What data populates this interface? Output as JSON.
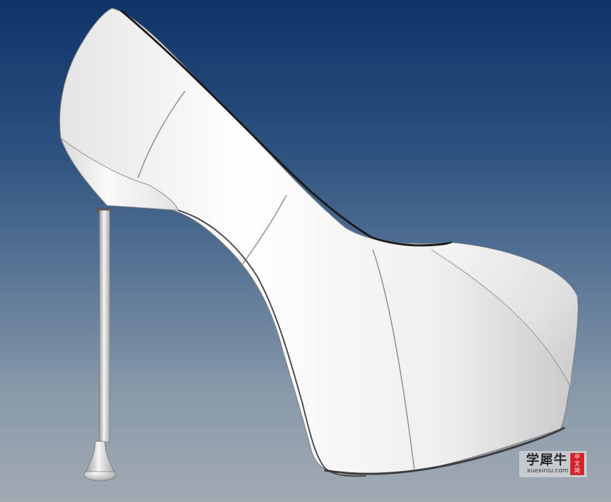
{
  "viewport": {
    "background_top": "#0e3468",
    "background_bottom": "#a2aab3",
    "model_color": "#f2f2f2",
    "content": "rendered high-heel platform shoe"
  },
  "watermark": {
    "title": "学犀牛",
    "url": "xuexiniu.com",
    "seal": [
      "中",
      "文",
      "网"
    ],
    "seal_color": "#d3222a"
  }
}
